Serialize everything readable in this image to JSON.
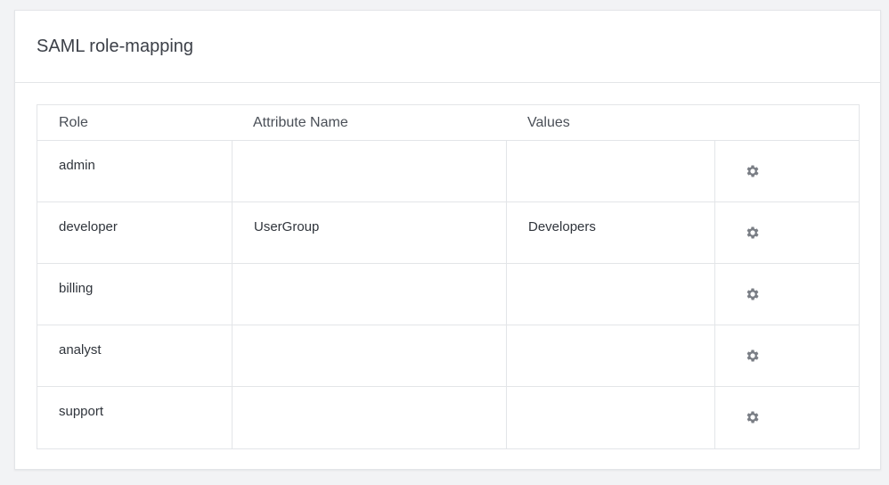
{
  "panel": {
    "title": "SAML role-mapping"
  },
  "table": {
    "headers": {
      "role": "Role",
      "attribute_name": "Attribute Name",
      "values": "Values"
    },
    "rows": [
      {
        "role": "admin",
        "attribute_name": "",
        "values": "",
        "action_icon": "gear-icon"
      },
      {
        "role": "developer",
        "attribute_name": "UserGroup",
        "values": "Developers",
        "action_icon": "gear-icon"
      },
      {
        "role": "billing",
        "attribute_name": "",
        "values": "",
        "action_icon": "gear-icon"
      },
      {
        "role": "analyst",
        "attribute_name": "",
        "values": "",
        "action_icon": "gear-icon"
      },
      {
        "role": "support",
        "attribute_name": "",
        "values": "",
        "action_icon": "gear-icon"
      }
    ]
  },
  "colors": {
    "page_background": "#f2f3f5",
    "panel_background": "#ffffff",
    "border": "#e3e5e8",
    "icon": "#7a7e85",
    "text": "#30353c"
  }
}
